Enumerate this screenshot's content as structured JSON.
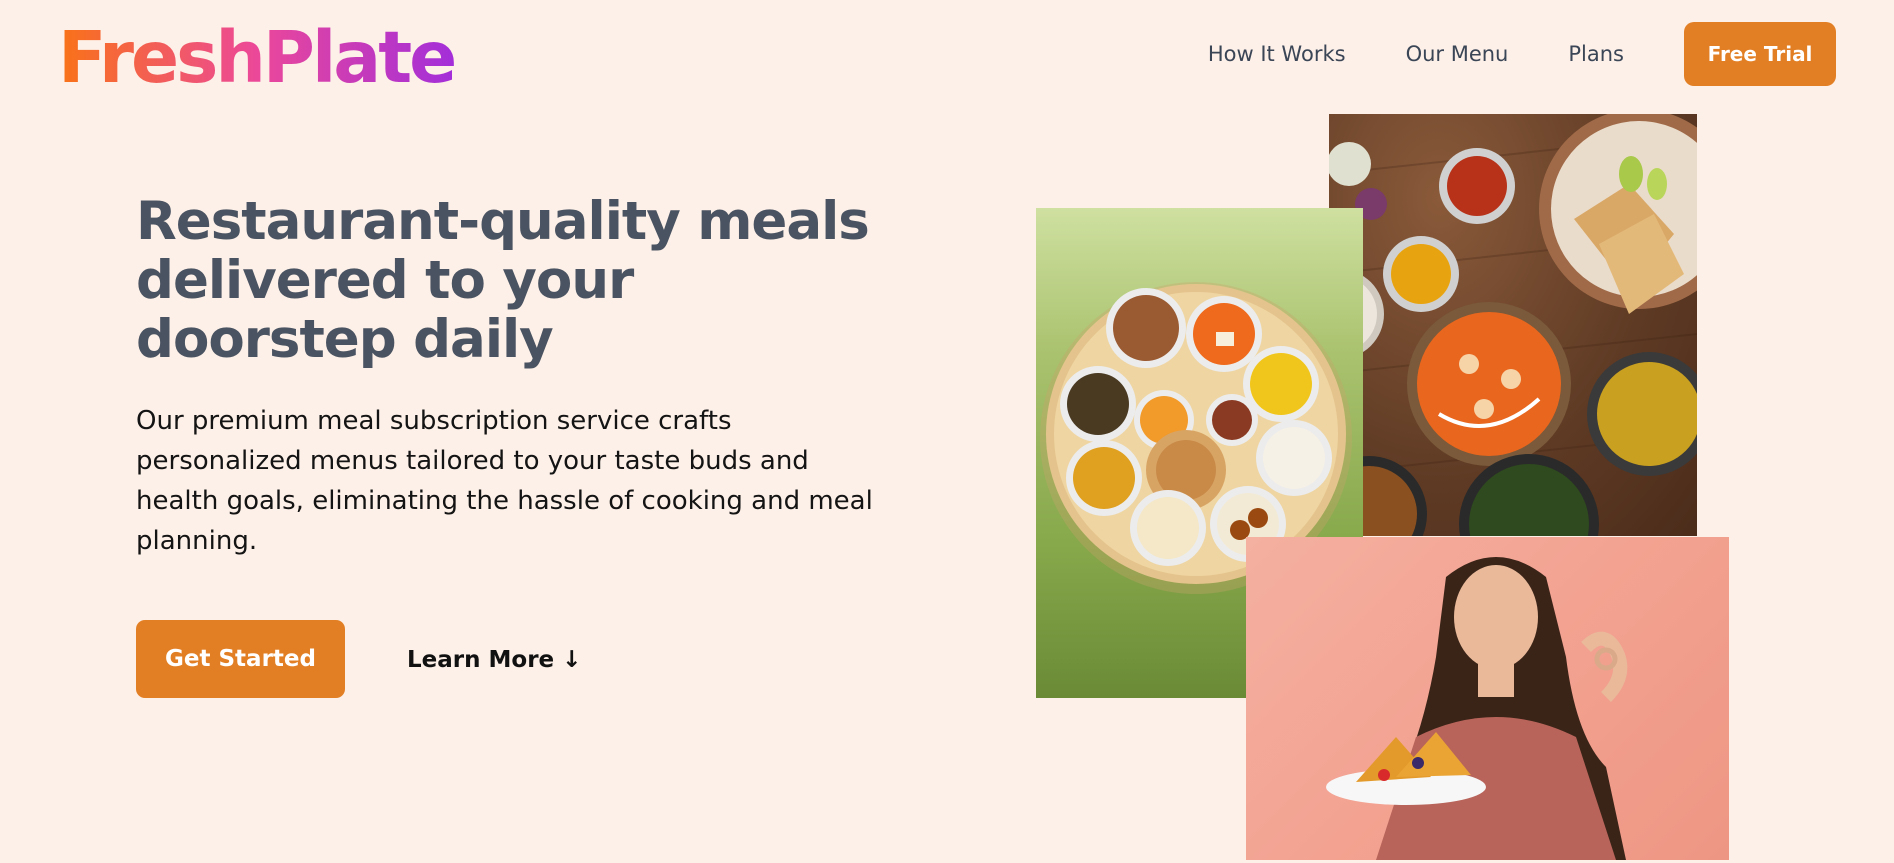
{
  "header": {
    "logo": "FreshPlate",
    "nav": [
      {
        "label": "How It Works"
      },
      {
        "label": "Our Menu"
      },
      {
        "label": "Plans"
      }
    ],
    "cta_label": "Free Trial"
  },
  "hero": {
    "title": "Restaurant-quality meals delivered to your doorstep daily",
    "description": "Our premium meal subscription service crafts personalized menus tailored to your taste buds and health goals, eliminating the hassle of cooking and meal planning.",
    "primary_button": "Get Started",
    "secondary_button": "Learn More",
    "secondary_arrow": "↓"
  },
  "colors": {
    "background": "#fdf0e8",
    "accent": "#e27f24",
    "heading": "#4a5361",
    "logo_gradient": [
      "#f97316",
      "#ec4899",
      "#a32ed9"
    ]
  }
}
